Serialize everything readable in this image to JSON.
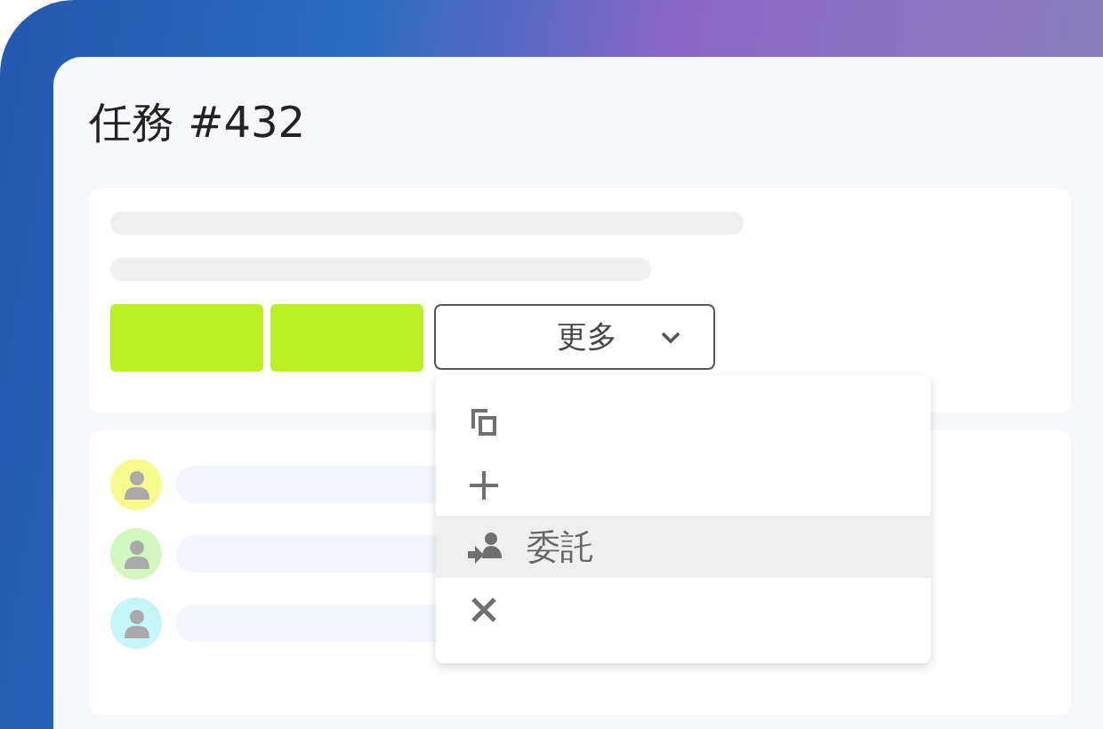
{
  "title": "任務 #432",
  "more_button": {
    "label": "更多",
    "expanded": true
  },
  "menu": [
    {
      "kind": "copy",
      "selected": false
    },
    {
      "kind": "add",
      "selected": false
    },
    {
      "kind": "delegate",
      "label": "委託",
      "selected": true
    },
    {
      "kind": "close",
      "selected": false
    }
  ],
  "assignees": [
    {
      "color": "#f7fb8c"
    },
    {
      "color": "#d2f8c0"
    },
    {
      "color": "#c6f7f7"
    }
  ]
}
